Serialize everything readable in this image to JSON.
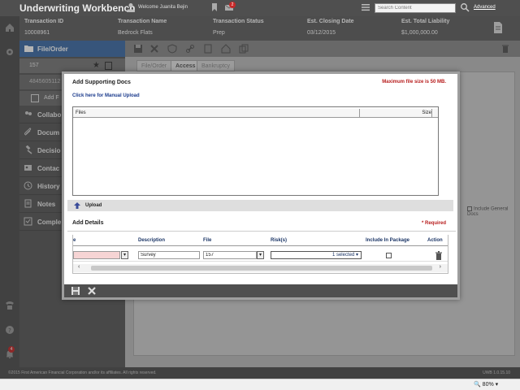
{
  "header": {
    "app_title": "Underwriting Workbench",
    "welcome": "Welcome Juanita Bejin",
    "mail_count": "2",
    "search_placeholder": "Search Content",
    "advanced_label": "Advanced"
  },
  "transaction": {
    "id_label": "Transaction ID",
    "id_value": "10008961",
    "name_label": "Transaction Name",
    "name_value": "Bedrock Flats",
    "status_label": "Transaction Status",
    "status_value": "Prep",
    "closing_label": "Est. Closing Date",
    "closing_value": "03/12/2015",
    "liability_label": "Est. Total Liability",
    "liability_value": "$1,000,000.00"
  },
  "rail": {
    "notification_count": "4"
  },
  "leftnav": {
    "head": "File/Order",
    "sub_1": "157",
    "sub_2": "4845605112",
    "sub_3": "Add F",
    "items": [
      {
        "label": "Collabo"
      },
      {
        "label": "Docum"
      },
      {
        "label": "Decisio"
      },
      {
        "label": "Contac"
      },
      {
        "label": "History"
      },
      {
        "label": "Notes"
      },
      {
        "label": "Comple"
      }
    ]
  },
  "main": {
    "tab_1": "File/Order",
    "tab_2": "Access",
    "tab_3": "Bankruptcy",
    "include_general": "Include General Docs"
  },
  "modal": {
    "title": "Add Supporting Docs",
    "max_size": "Maximum file size is 50 MB.",
    "manual_upload": "Click here for Manual Upload",
    "files_col": "Files",
    "size_col": "Size",
    "upload_label": "Upload",
    "add_details": "Add Details",
    "required": "* Required",
    "grid": {
      "col_name_partial": "e",
      "col_description": "Description",
      "col_file": "File",
      "col_risks": "Risk(s)",
      "col_include": "Include In Package",
      "col_action": "Action",
      "row": {
        "description": "Survey",
        "file": "157",
        "risks": "1 selected"
      }
    }
  },
  "footer": {
    "copyright": "©2015 First American Financial Corporation and/or its affiliates. All rights reserved.",
    "version": "UWB 1.0.15.10"
  },
  "statusbar": {
    "zoom": "80%"
  },
  "colors": {
    "accent_blue": "#3f6ea8",
    "required_red": "#b71c1c",
    "header_bg": "#4f4f4f"
  }
}
